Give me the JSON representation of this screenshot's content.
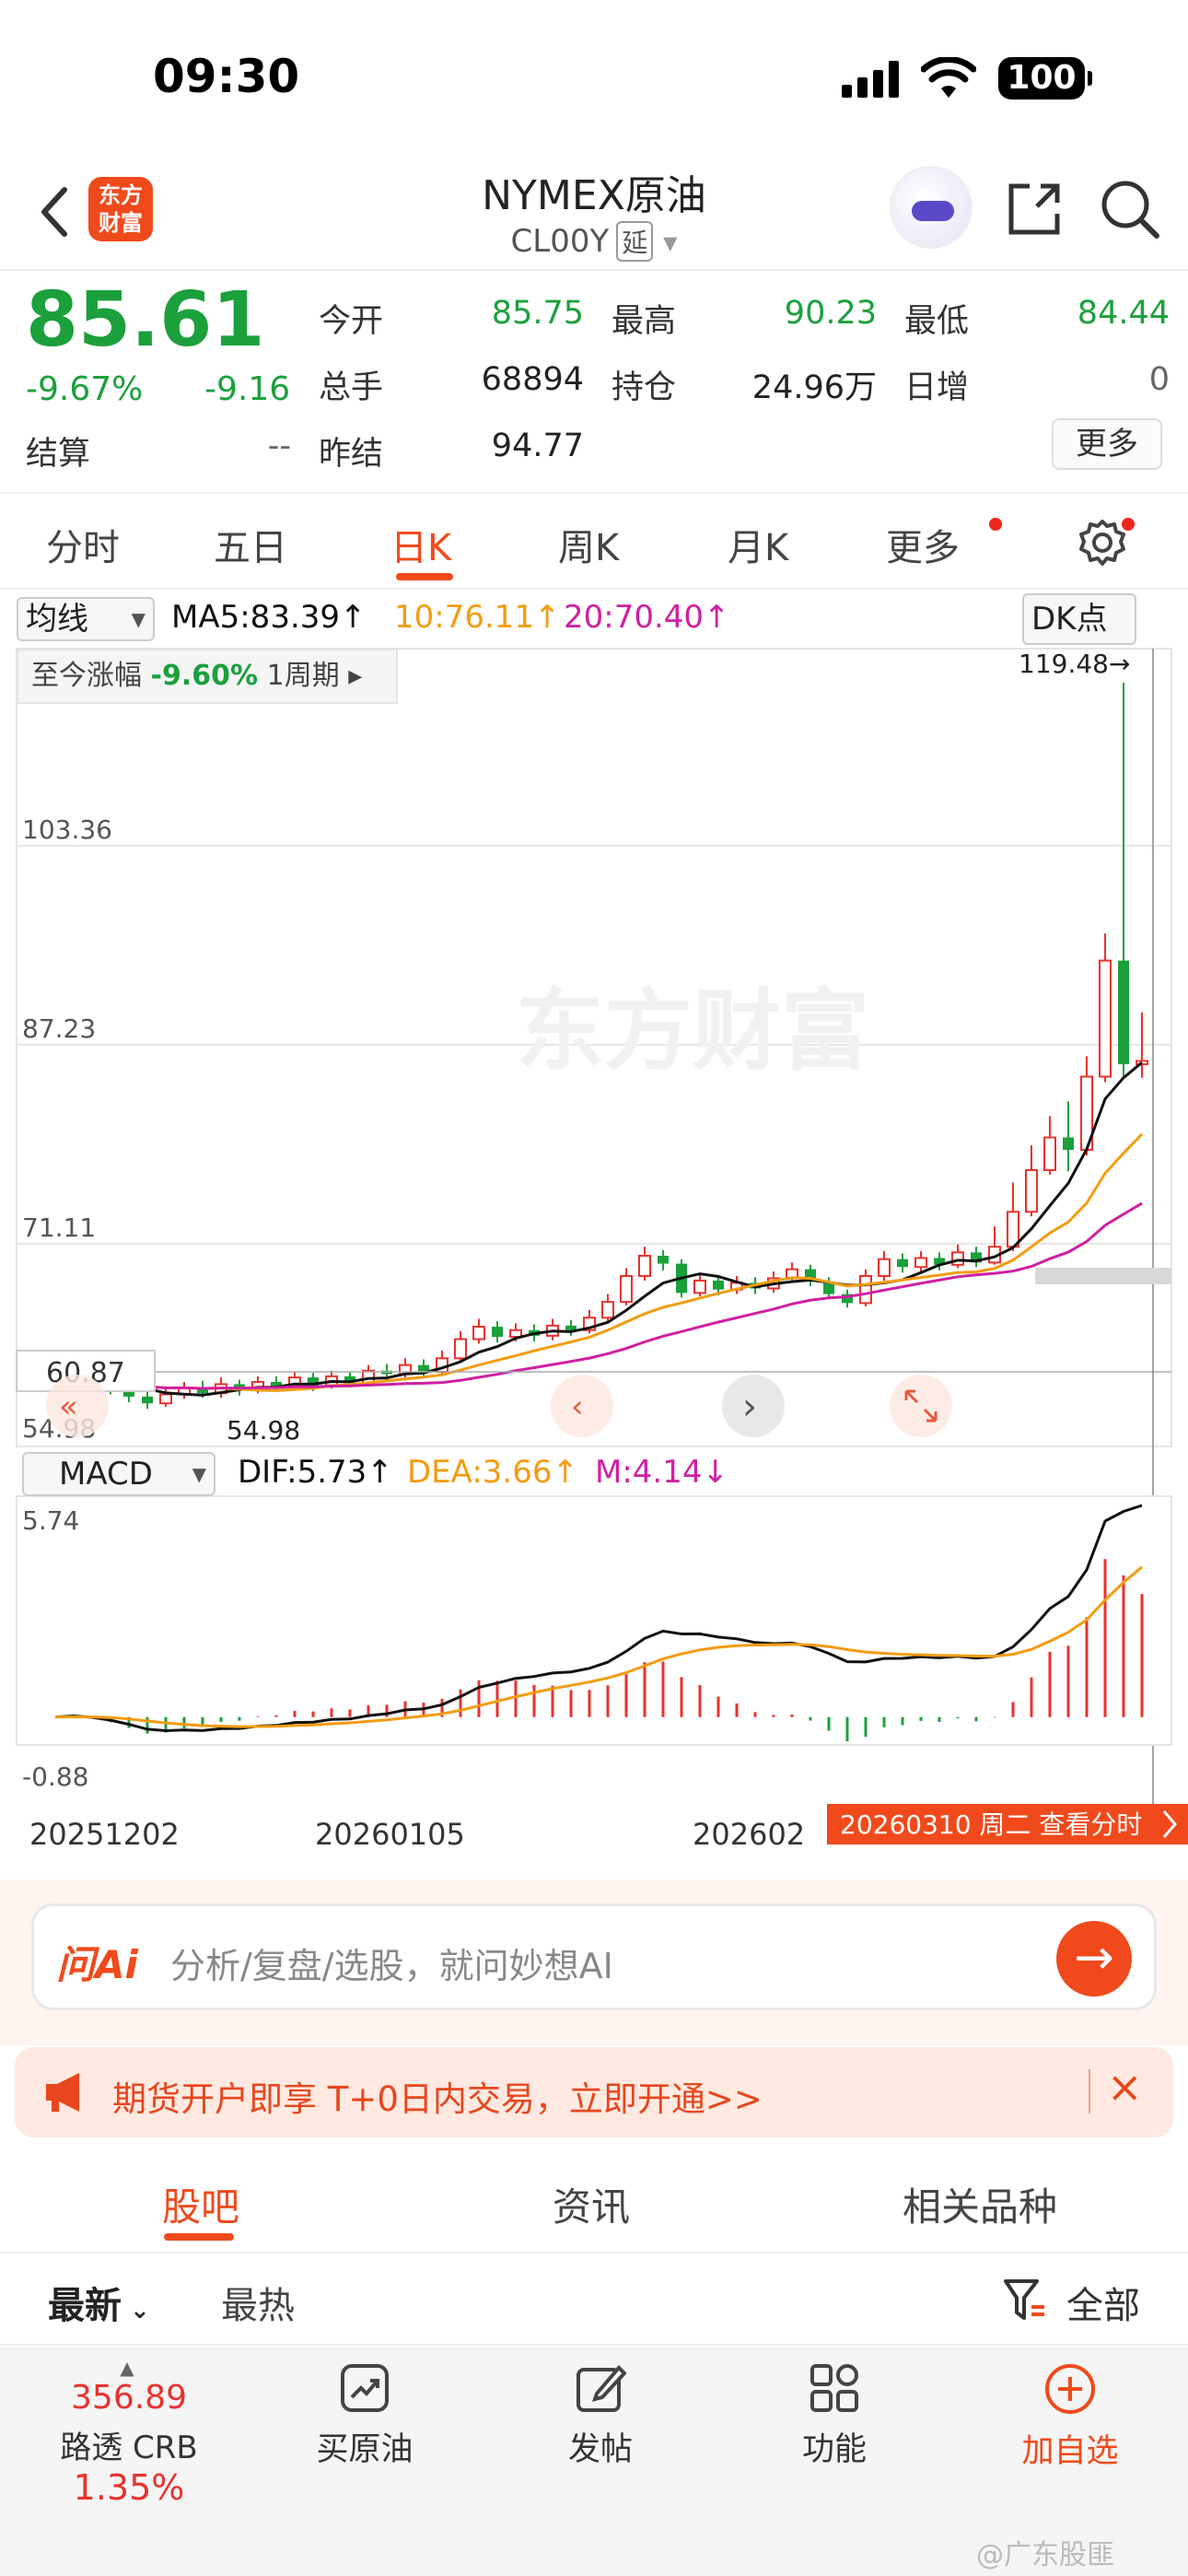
{
  "status": {
    "time": "09:30",
    "battery": "100"
  },
  "nav": {
    "back_icon": "chevron-left-icon",
    "logo_text": "东方财富",
    "title": "NYMEX原油",
    "code": "CL00Y",
    "delay_badge": "延",
    "caret": "▼"
  },
  "quote": {
    "price": "85.61",
    "pct": "-9.67%",
    "chg": "-9.16",
    "items": [
      {
        "label": "今开",
        "value": "85.75"
      },
      {
        "label": "最高",
        "value": "90.23"
      },
      {
        "label": "最低",
        "value": "84.44"
      },
      {
        "label": "总手",
        "value": "68894"
      },
      {
        "label": "持仓",
        "value": "24.96万"
      },
      {
        "label": "日增",
        "value": "0"
      },
      {
        "label": "结算",
        "value": "--"
      },
      {
        "label": "昨结",
        "value": "94.77"
      }
    ],
    "more": "更多"
  },
  "tabs": [
    {
      "label": "分时"
    },
    {
      "label": "五日"
    },
    {
      "label": "日K"
    },
    {
      "label": "周K"
    },
    {
      "label": "月K"
    },
    {
      "label": "更多"
    }
  ],
  "chart_bar": {
    "ma_select": "均线",
    "ma5": "MA5:83.39↑",
    "ma10": "10:76.11↑",
    "ma20": "20:70.40↑",
    "dk": "DK点",
    "range_label": "至今涨幅",
    "range_value": "-9.60%",
    "range_period": "1周期"
  },
  "chart_data": [
    {
      "type": "candlestick",
      "y_ticks": [
        "103.36",
        "87.23",
        "71.11"
      ],
      "y_left_label": "60.87",
      "high_label": "119.48→",
      "low_label": "54.98",
      "low_mark": "54.98",
      "ylim": [
        52,
        122
      ],
      "candles": [
        [
          58.5,
          57.8,
          58.9,
          57.4
        ],
        [
          57.8,
          58.2,
          58.8,
          57.2
        ],
        [
          58.2,
          57.4,
          58.6,
          57.0
        ],
        [
          57.4,
          56.8,
          57.9,
          56.3
        ],
        [
          56.8,
          56.1,
          57.2,
          55.6
        ],
        [
          56.1,
          55.5,
          56.6,
          55.0
        ],
        [
          55.5,
          56.3,
          56.9,
          55.2
        ],
        [
          56.3,
          56.9,
          57.4,
          55.9
        ],
        [
          56.9,
          56.4,
          57.5,
          56.0
        ],
        [
          56.4,
          57.2,
          57.8,
          56.0
        ],
        [
          57.2,
          56.7,
          57.6,
          56.2
        ],
        [
          56.7,
          57.4,
          57.9,
          56.4
        ],
        [
          57.4,
          57.0,
          57.9,
          56.6
        ],
        [
          57.0,
          57.8,
          58.3,
          56.7
        ],
        [
          57.8,
          57.1,
          58.2,
          56.6
        ],
        [
          57.1,
          57.9,
          58.4,
          56.8
        ],
        [
          57.9,
          57.3,
          58.3,
          56.9
        ],
        [
          57.3,
          58.4,
          58.9,
          57.0
        ],
        [
          58.4,
          58.1,
          59.0,
          57.6
        ],
        [
          58.1,
          58.9,
          59.5,
          57.8
        ],
        [
          58.9,
          58.3,
          59.4,
          57.9
        ],
        [
          58.3,
          59.5,
          60.2,
          58.0
        ],
        [
          59.5,
          61.2,
          61.9,
          59.2
        ],
        [
          61.2,
          62.3,
          63.0,
          60.8
        ],
        [
          62.3,
          61.4,
          62.8,
          60.9
        ],
        [
          61.4,
          62.0,
          62.6,
          61.0
        ],
        [
          62.0,
          61.5,
          62.5,
          61.0
        ],
        [
          61.5,
          62.4,
          63.0,
          61.1
        ],
        [
          62.4,
          62.0,
          62.9,
          61.5
        ],
        [
          62.0,
          63.1,
          63.8,
          61.7
        ],
        [
          63.1,
          64.5,
          65.2,
          62.8
        ],
        [
          64.5,
          66.8,
          67.5,
          64.2
        ],
        [
          66.8,
          68.6,
          69.4,
          66.4
        ],
        [
          68.6,
          67.9,
          69.1,
          67.3
        ],
        [
          67.9,
          65.3,
          68.3,
          64.9
        ],
        [
          65.3,
          66.4,
          67.0,
          65.0
        ],
        [
          66.4,
          65.6,
          66.9,
          65.1
        ],
        [
          65.6,
          66.2,
          66.8,
          65.2
        ],
        [
          66.2,
          65.7,
          66.7,
          65.2
        ],
        [
          65.7,
          66.6,
          67.2,
          65.3
        ],
        [
          66.6,
          67.4,
          68.0,
          66.2
        ],
        [
          67.4,
          66.3,
          67.8,
          65.9
        ],
        [
          66.3,
          65.2,
          66.7,
          64.8
        ],
        [
          65.2,
          64.4,
          65.6,
          64.0
        ],
        [
          64.4,
          66.8,
          67.4,
          64.1
        ],
        [
          66.8,
          68.3,
          69.0,
          66.4
        ],
        [
          68.3,
          67.6,
          68.8,
          67.1
        ],
        [
          67.6,
          68.4,
          69.0,
          67.2
        ],
        [
          68.4,
          67.8,
          68.9,
          67.3
        ],
        [
          67.8,
          68.9,
          69.6,
          67.5
        ],
        [
          68.9,
          68.0,
          69.4,
          67.6
        ],
        [
          68.0,
          69.4,
          71.2,
          67.8
        ],
        [
          69.4,
          72.5,
          75.1,
          69.0
        ],
        [
          72.5,
          76.2,
          78.4,
          72.1
        ],
        [
          76.2,
          79.1,
          81.0,
          75.8
        ],
        [
          79.1,
          78.0,
          82.3,
          76.1
        ],
        [
          78.0,
          84.5,
          86.3,
          77.5
        ],
        [
          84.5,
          94.8,
          97.2,
          84.0
        ],
        [
          94.8,
          85.6,
          119.48,
          84.44
        ],
        [
          85.6,
          85.9,
          90.2,
          84.4
        ]
      ],
      "ma5_end": 83.39,
      "ma10_end": 76.11,
      "ma20_end": 70.4
    },
    {
      "type": "macd",
      "select": "MACD",
      "dif": "DIF:5.73↑",
      "dea": "DEA:3.66↑",
      "m": "M:4.14↓",
      "y_top": "5.74",
      "y_bottom": "-0.88",
      "dates": [
        "20251202",
        "20260105",
        "202602",
        "20260310 周二 查看分时"
      ]
    }
  ],
  "ask": {
    "logo": "问Ai",
    "placeholder": "分析/复盘/选股，就问妙想AI"
  },
  "ad": {
    "text": "期货开户即享 T+0日内交易，立即开通>>",
    "close": "×"
  },
  "guba_tabs": [
    {
      "label": "股吧"
    },
    {
      "label": "资讯"
    },
    {
      "label": "相关品种"
    }
  ],
  "filter": {
    "latest": "最新",
    "hot": "最热",
    "all": "全部"
  },
  "bottom": {
    "related_price": "356.89",
    "related_name": "路透 CRB",
    "related_pct": "1.35%",
    "items": [
      {
        "label": "买原油"
      },
      {
        "label": "发帖"
      },
      {
        "label": "功能"
      },
      {
        "label": "加自选"
      }
    ]
  },
  "watermark": "@广东股匪",
  "chart_watermark": "东方财富",
  "colors": {
    "up": "#e8322d",
    "down": "#1ba03c",
    "accent": "#f04a1c",
    "ma5": "#111111",
    "ma10": "#f39c12",
    "ma20": "#d01fa3"
  }
}
